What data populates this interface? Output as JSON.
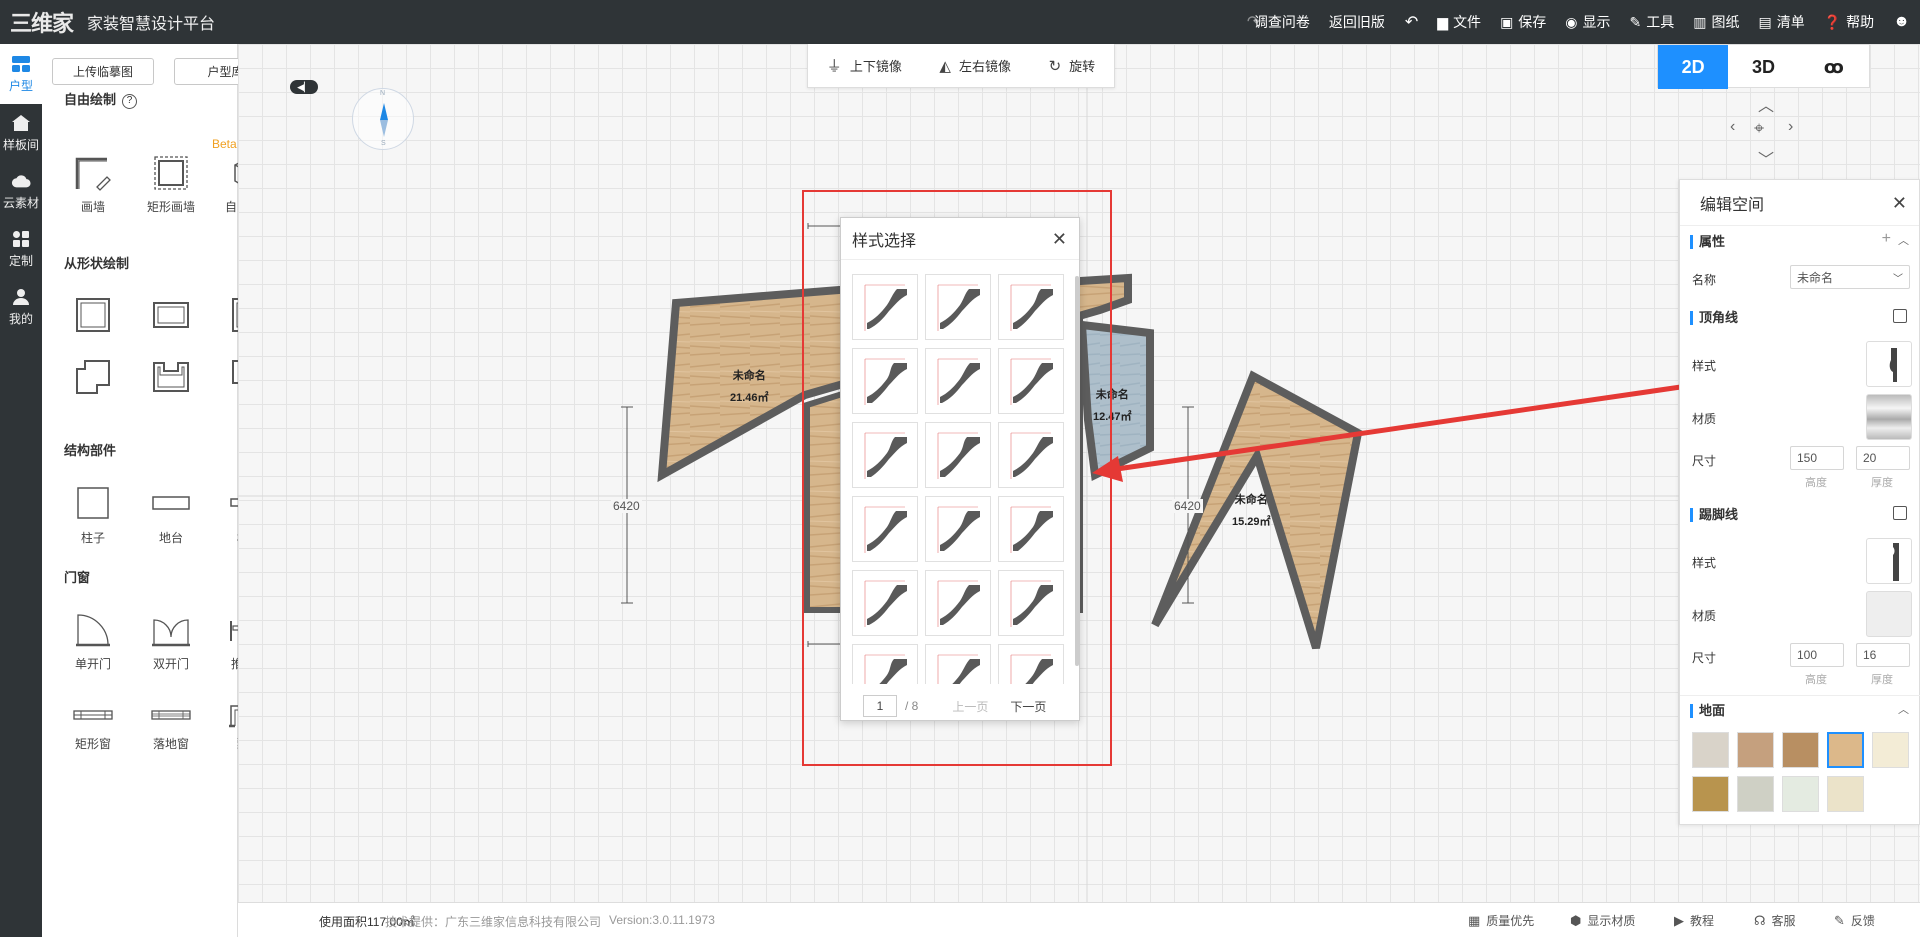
{
  "app": {
    "logo_mark": "三维家",
    "title": "家装智慧设计平台"
  },
  "topmenu": {
    "survey": "调查问卷",
    "old_version": "返回旧版",
    "undo_icon": "undo-icon",
    "redo_icon": "redo-icon",
    "file": "文件",
    "save": "保存",
    "display": "显示",
    "tools": "工具",
    "drawings": "图纸",
    "list": "清单",
    "help": "帮助",
    "user_icon": "user-icon"
  },
  "rail": [
    {
      "label": "户型",
      "icon": "floorplan-icon",
      "active": true
    },
    {
      "label": "样板间",
      "icon": "house-icon"
    },
    {
      "label": "云素材",
      "icon": "cloud-icon"
    },
    {
      "label": "定制",
      "icon": "grid-icon"
    },
    {
      "label": "我的",
      "icon": "user-icon"
    }
  ],
  "leftpanel": {
    "upload_btn": "上传临摹图",
    "library_btn": "户型库",
    "free_draw": "自由绘制",
    "beta": "Beta",
    "free_tools": [
      "画墙",
      "矩形画墙",
      "自由建模"
    ],
    "shape_draw": "从形状绘制",
    "structure": "结构部件",
    "structure_tools": [
      "柱子",
      "地台",
      "横梁"
    ],
    "doors_windows": "门窗",
    "door_tools": [
      "单开门",
      "双开门",
      "推拉门"
    ],
    "window_tools": [
      "矩形窗",
      "落地窗",
      "飘窗"
    ]
  },
  "mirrorbar": {
    "vertical": "上下镜像",
    "horizontal": "左右镜像",
    "rotate": "旋转"
  },
  "view": {
    "v2d": "2D",
    "v3d": "3D",
    "vr": "ꝏ",
    "active": "2D"
  },
  "compass": {
    "n": "N",
    "s": "S"
  },
  "rooms": [
    {
      "name": "未命名",
      "area": "21.46㎡"
    },
    {
      "name": "未命名",
      "area": "12.47㎡"
    },
    {
      "name": "未命名",
      "area": "15.29㎡"
    }
  ],
  "dimensions": {
    "left": "6420",
    "right": "6420"
  },
  "dialog": {
    "title": "样式选择",
    "page": "1",
    "total": "/ 8",
    "prev": "上一页",
    "next": "下一页",
    "rows": 6,
    "cols": 3
  },
  "rightpanel": {
    "title": "编辑空间",
    "attributes": "属性",
    "name_label": "名称",
    "name_value": "未命名",
    "crown": "顶角线",
    "style": "样式",
    "material": "材质",
    "size": "尺寸",
    "crown_height": "150",
    "crown_thickness": "20",
    "height": "高度",
    "thickness": "厚度",
    "skirting": "踢脚线",
    "skirt_height": "100",
    "skirt_thickness": "16",
    "floor": "地面",
    "swatches": [
      "#d9d3c9",
      "#c5a07e",
      "#b88f62",
      "#dcb88a",
      "#f3ecd6",
      "#b8944e",
      "#cfd0c5",
      "#e4ebe1",
      "#ebe3c9"
    ],
    "selected_swatch": 3
  },
  "bottom": {
    "area": "使用面积117.00㎡",
    "provider": "技术提供：广东三维家信息科技有限公司",
    "version": "Version:3.0.11.1973",
    "quality": "质量优先",
    "show_material": "显示材质",
    "tutorial": "教程",
    "service": "客服",
    "feedback": "反馈"
  }
}
